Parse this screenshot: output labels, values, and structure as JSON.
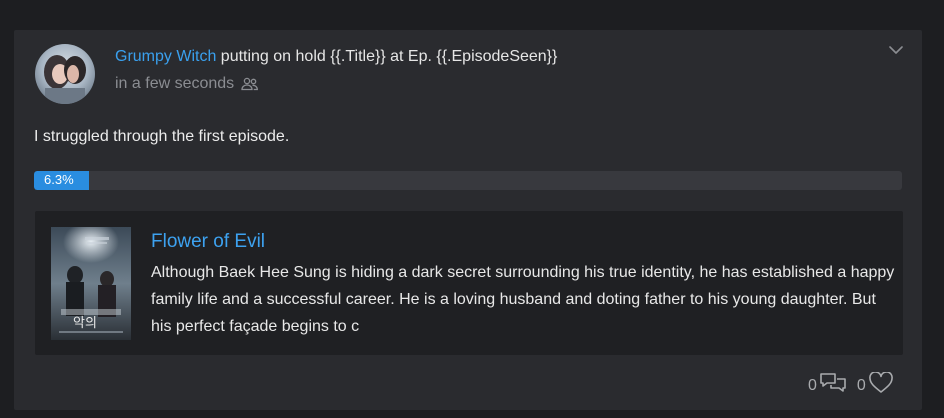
{
  "activity": {
    "username": "Grumpy Witch",
    "action_text": " putting on hold {{.Title}} at Ep. {{.EpisodeSeen}}",
    "time": "in a few seconds",
    "visibility_icon": "people-icon",
    "menu_icon": "chevron-down-icon"
  },
  "comment": "I struggled through the first episode.",
  "progress": {
    "label": "6.3%",
    "value_percent": 6.3
  },
  "show": {
    "title": "Flower of Evil",
    "description": "Although Baek Hee Sung is hiding a dark secret surrounding his true identity, he has established a happy family life and a successful career. He is a loving husband and doting father to his young daughter. But his perfect façade begins to c"
  },
  "actions": {
    "comments_count": "0",
    "comments_icon": "comments-icon",
    "likes_count": "0",
    "likes_icon": "heart-icon"
  },
  "colors": {
    "accent": "#3aa0ee",
    "progress": "#2a8de0",
    "card": "#2a2b2f",
    "background": "#1d1e21"
  }
}
